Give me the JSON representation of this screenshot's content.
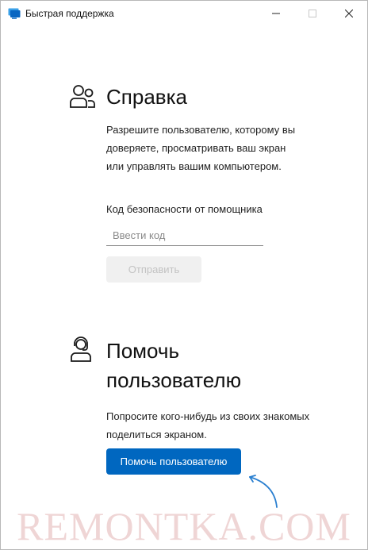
{
  "window": {
    "title": "Быстрая поддержка",
    "icons": {
      "app": "quick-assist-icon",
      "minimize": "minimize-icon",
      "maximize": "maximize-icon",
      "close": "close-icon"
    }
  },
  "help_section": {
    "icon": "people-icon",
    "title": "Справка",
    "description": "Разрешите пользователю, которому вы доверяете, просматривать ваш экран или управлять вашим компьютером.",
    "code_label": "Код безопасности от помощника",
    "code_input": {
      "value": "",
      "placeholder": "Ввести код"
    },
    "submit_label": "Отправить"
  },
  "assist_section": {
    "icon": "person-headset-icon",
    "title": "Помочь пользователю",
    "description": "Попросите кого-нибудь из своих знакомых поделиться экраном.",
    "button_label": "Помочь пользователю"
  },
  "overlay": {
    "watermark": "REMONTKA.COM",
    "arrow_icon": "curved-arrow-icon"
  },
  "colors": {
    "accent": "#0067c0",
    "disabled_bg": "#f0f0f0",
    "disabled_text": "#c3c3c3",
    "watermark": "#e1b2b2"
  }
}
